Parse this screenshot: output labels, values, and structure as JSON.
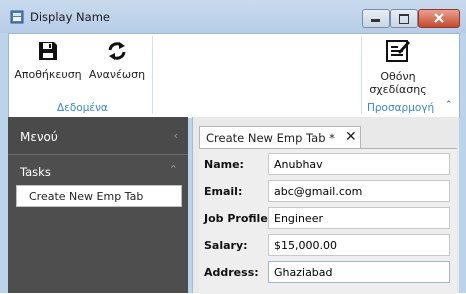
{
  "window": {
    "title": "Display Name"
  },
  "ribbon": {
    "groups": [
      {
        "label": "Δεδομένα",
        "buttons": [
          {
            "label": "Αποθήκευση",
            "icon": "save-icon"
          },
          {
            "label": "Ανανέωση",
            "icon": "refresh-icon"
          }
        ]
      },
      {
        "label": "Προσαρμογή",
        "buttons": [
          {
            "label_line1": "Οθόνη",
            "label_line2": "σχεδίασης",
            "icon": "designer-icon"
          }
        ]
      }
    ]
  },
  "nav": {
    "header": "Μενού",
    "group": "Tasks",
    "items": [
      {
        "label": "Create New Emp Tab"
      }
    ]
  },
  "tab": {
    "label": "Create New Emp Tab",
    "modified_marker": "*"
  },
  "form": {
    "fields": [
      {
        "label": "Name:",
        "value": "Anubhav"
      },
      {
        "label": "Email:",
        "value": "abc@gmail.com"
      },
      {
        "label": "Job Profile:",
        "value": "Engineer"
      },
      {
        "label": "Salary:",
        "value": "$15,000.00"
      },
      {
        "label": "Address:",
        "value": "Ghaziabad"
      }
    ]
  },
  "colors": {
    "accent": "#3a86c8",
    "nav_bg": "#4e4e4e",
    "close_red": "#c84a2e"
  }
}
